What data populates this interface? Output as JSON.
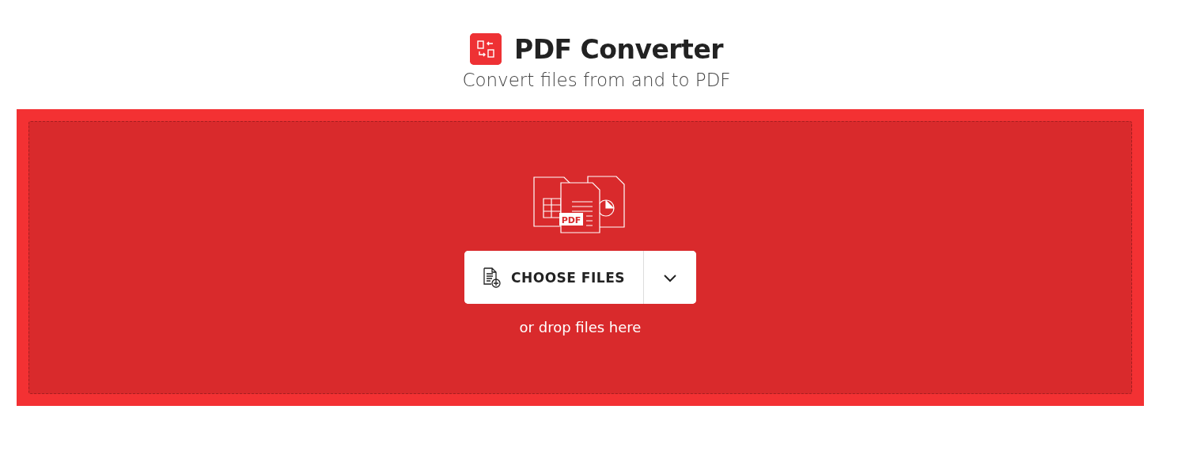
{
  "header": {
    "title": "PDF Converter",
    "subtitle": "Convert files from and to PDF"
  },
  "dropzone": {
    "illustration_label": "PDF",
    "choose_button": "CHOOSE FILES",
    "hint": "or drop files here"
  }
}
